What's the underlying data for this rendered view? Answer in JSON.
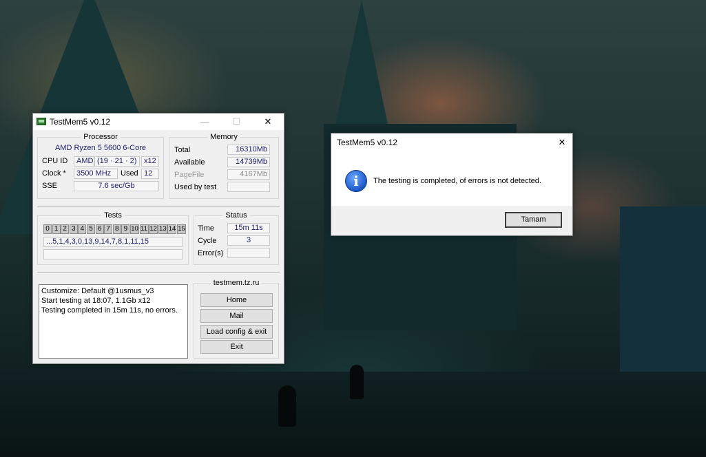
{
  "main_window": {
    "title": "TestMem5 v0.12",
    "processor": {
      "group_title": "Processor",
      "cpu_name": "AMD Ryzen 5 5600 6-Core",
      "cpu_id_label": "CPU ID",
      "cpu_vendor": "AMD",
      "cpu_id": "(19 · 21 · 2)",
      "cpu_threads": "x12",
      "clock_label": "Clock *",
      "clock": "3500 MHz",
      "used_label": "Used",
      "used": "12",
      "sse_label": "SSE",
      "sse": "7.6 sec/Gb"
    },
    "memory": {
      "group_title": "Memory",
      "total_label": "Total",
      "total": "16310Mb",
      "available_label": "Available",
      "available": "14739Mb",
      "pagefile_label": "PageFile",
      "pagefile": "4167Mb",
      "used_by_test_label": "Used by test",
      "used_by_test": ""
    },
    "tests": {
      "group_title": "Tests",
      "cells": [
        "0",
        "1",
        "2",
        "3",
        "4",
        "5",
        "6",
        "7",
        "8",
        "9",
        "10",
        "11",
        "12",
        "13",
        "14",
        "15"
      ],
      "sequence": "...5,1,4,3,0,13,9,14,7,8,1,11,15",
      "progress_text": ""
    },
    "status": {
      "group_title": "Status",
      "time_label": "Time",
      "time": "15m 11s",
      "cycle_label": "Cycle",
      "cycle": "3",
      "errors_label": "Error(s)",
      "errors": ""
    },
    "log": [
      "Customize: Default @1usmus_v3",
      "Start testing at 18:07, 1.1Gb x12",
      "Testing completed in 15m 11s, no errors."
    ],
    "links": {
      "group_title": "testmem.tz.ru",
      "home": "Home",
      "mail": "Mail",
      "load_config": "Load config & exit",
      "exit": "Exit"
    },
    "controls": {
      "minimize": "—",
      "maximize": "☐",
      "close": "✕"
    }
  },
  "dialog": {
    "title": "TestMem5 v0.12",
    "message": "The testing is completed, of errors is not detected.",
    "ok_label": "Tamam",
    "close": "✕",
    "icon": "info-icon"
  }
}
